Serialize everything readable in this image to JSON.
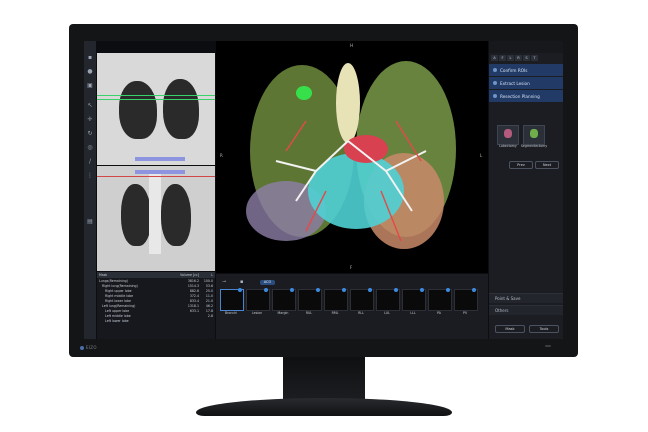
{
  "table": {
    "headers": [
      "Mask",
      "Volume [cc]",
      "L"
    ],
    "rows": [
      {
        "name": "Lungs(Remaining)",
        "volume": "3816.2",
        "pct": "100.0"
      },
      {
        "name": "Right lung(Remaining)",
        "volume": "1514.3",
        "pct": "53.6"
      },
      {
        "name": "Right upper lobe",
        "volume": "882.6",
        "pct": "25.0"
      },
      {
        "name": "Right middle lobe",
        "volume": "372.4",
        "pct": "11.0"
      },
      {
        "name": "Right lower lobe",
        "volume": "833.4",
        "pct": "21.0"
      },
      {
        "name": "Left lung(Remaining)",
        "volume": "1318.1",
        "pct": "46.2"
      },
      {
        "name": "Left upper lobe",
        "volume": "633.1",
        "pct": "17.8"
      },
      {
        "name": "Left middle lobe",
        "volume": "",
        "pct": "2.8"
      },
      {
        "name": "Left lower lobe",
        "volume": "",
        "pct": ""
      }
    ]
  },
  "view3d": {
    "orient_top": "H",
    "orient_left": "R",
    "orient_right": "L",
    "orient_bottom": "F"
  },
  "thumbs": {
    "chip": "ACO",
    "items": [
      "Bronchi",
      "Lesion",
      "Margin",
      "RUL",
      "RML",
      "RLL",
      "LUL",
      "LLL",
      "PA",
      "PV"
    ]
  },
  "right_panel": {
    "tabs": [
      "A",
      "F",
      "L",
      "R",
      "S",
      "T"
    ],
    "steps": [
      "Confirm ROIs",
      "Extract Lesion",
      "Resection Planning"
    ],
    "options": [
      "Lobectomy",
      "Segmentectomy"
    ],
    "prev": "Prev",
    "next": "Next",
    "section1": "Point & Save",
    "section2": "Others",
    "mask_btn": "Mask",
    "tools_btn": "Tools"
  },
  "brand": "EIZO",
  "colors": {
    "accent": "#2a4c7c",
    "selected": "#4a86d0"
  }
}
